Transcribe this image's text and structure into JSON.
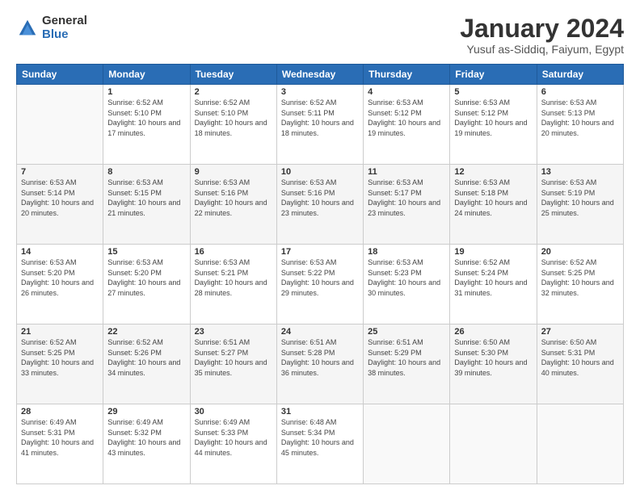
{
  "logo": {
    "general": "General",
    "blue": "Blue"
  },
  "header": {
    "title": "January 2024",
    "subtitle": "Yusuf as-Siddiq, Faiyum, Egypt"
  },
  "weekdays": [
    "Sunday",
    "Monday",
    "Tuesday",
    "Wednesday",
    "Thursday",
    "Friday",
    "Saturday"
  ],
  "weeks": [
    [
      {
        "day": "",
        "sunrise": "",
        "sunset": "",
        "daylight": ""
      },
      {
        "day": "1",
        "sunrise": "Sunrise: 6:52 AM",
        "sunset": "Sunset: 5:10 PM",
        "daylight": "Daylight: 10 hours and 17 minutes."
      },
      {
        "day": "2",
        "sunrise": "Sunrise: 6:52 AM",
        "sunset": "Sunset: 5:10 PM",
        "daylight": "Daylight: 10 hours and 18 minutes."
      },
      {
        "day": "3",
        "sunrise": "Sunrise: 6:52 AM",
        "sunset": "Sunset: 5:11 PM",
        "daylight": "Daylight: 10 hours and 18 minutes."
      },
      {
        "day": "4",
        "sunrise": "Sunrise: 6:53 AM",
        "sunset": "Sunset: 5:12 PM",
        "daylight": "Daylight: 10 hours and 19 minutes."
      },
      {
        "day": "5",
        "sunrise": "Sunrise: 6:53 AM",
        "sunset": "Sunset: 5:12 PM",
        "daylight": "Daylight: 10 hours and 19 minutes."
      },
      {
        "day": "6",
        "sunrise": "Sunrise: 6:53 AM",
        "sunset": "Sunset: 5:13 PM",
        "daylight": "Daylight: 10 hours and 20 minutes."
      }
    ],
    [
      {
        "day": "7",
        "sunrise": "Sunrise: 6:53 AM",
        "sunset": "Sunset: 5:14 PM",
        "daylight": "Daylight: 10 hours and 20 minutes."
      },
      {
        "day": "8",
        "sunrise": "Sunrise: 6:53 AM",
        "sunset": "Sunset: 5:15 PM",
        "daylight": "Daylight: 10 hours and 21 minutes."
      },
      {
        "day": "9",
        "sunrise": "Sunrise: 6:53 AM",
        "sunset": "Sunset: 5:16 PM",
        "daylight": "Daylight: 10 hours and 22 minutes."
      },
      {
        "day": "10",
        "sunrise": "Sunrise: 6:53 AM",
        "sunset": "Sunset: 5:16 PM",
        "daylight": "Daylight: 10 hours and 23 minutes."
      },
      {
        "day": "11",
        "sunrise": "Sunrise: 6:53 AM",
        "sunset": "Sunset: 5:17 PM",
        "daylight": "Daylight: 10 hours and 23 minutes."
      },
      {
        "day": "12",
        "sunrise": "Sunrise: 6:53 AM",
        "sunset": "Sunset: 5:18 PM",
        "daylight": "Daylight: 10 hours and 24 minutes."
      },
      {
        "day": "13",
        "sunrise": "Sunrise: 6:53 AM",
        "sunset": "Sunset: 5:19 PM",
        "daylight": "Daylight: 10 hours and 25 minutes."
      }
    ],
    [
      {
        "day": "14",
        "sunrise": "Sunrise: 6:53 AM",
        "sunset": "Sunset: 5:20 PM",
        "daylight": "Daylight: 10 hours and 26 minutes."
      },
      {
        "day": "15",
        "sunrise": "Sunrise: 6:53 AM",
        "sunset": "Sunset: 5:20 PM",
        "daylight": "Daylight: 10 hours and 27 minutes."
      },
      {
        "day": "16",
        "sunrise": "Sunrise: 6:53 AM",
        "sunset": "Sunset: 5:21 PM",
        "daylight": "Daylight: 10 hours and 28 minutes."
      },
      {
        "day": "17",
        "sunrise": "Sunrise: 6:53 AM",
        "sunset": "Sunset: 5:22 PM",
        "daylight": "Daylight: 10 hours and 29 minutes."
      },
      {
        "day": "18",
        "sunrise": "Sunrise: 6:53 AM",
        "sunset": "Sunset: 5:23 PM",
        "daylight": "Daylight: 10 hours and 30 minutes."
      },
      {
        "day": "19",
        "sunrise": "Sunrise: 6:52 AM",
        "sunset": "Sunset: 5:24 PM",
        "daylight": "Daylight: 10 hours and 31 minutes."
      },
      {
        "day": "20",
        "sunrise": "Sunrise: 6:52 AM",
        "sunset": "Sunset: 5:25 PM",
        "daylight": "Daylight: 10 hours and 32 minutes."
      }
    ],
    [
      {
        "day": "21",
        "sunrise": "Sunrise: 6:52 AM",
        "sunset": "Sunset: 5:25 PM",
        "daylight": "Daylight: 10 hours and 33 minutes."
      },
      {
        "day": "22",
        "sunrise": "Sunrise: 6:52 AM",
        "sunset": "Sunset: 5:26 PM",
        "daylight": "Daylight: 10 hours and 34 minutes."
      },
      {
        "day": "23",
        "sunrise": "Sunrise: 6:51 AM",
        "sunset": "Sunset: 5:27 PM",
        "daylight": "Daylight: 10 hours and 35 minutes."
      },
      {
        "day": "24",
        "sunrise": "Sunrise: 6:51 AM",
        "sunset": "Sunset: 5:28 PM",
        "daylight": "Daylight: 10 hours and 36 minutes."
      },
      {
        "day": "25",
        "sunrise": "Sunrise: 6:51 AM",
        "sunset": "Sunset: 5:29 PM",
        "daylight": "Daylight: 10 hours and 38 minutes."
      },
      {
        "day": "26",
        "sunrise": "Sunrise: 6:50 AM",
        "sunset": "Sunset: 5:30 PM",
        "daylight": "Daylight: 10 hours and 39 minutes."
      },
      {
        "day": "27",
        "sunrise": "Sunrise: 6:50 AM",
        "sunset": "Sunset: 5:31 PM",
        "daylight": "Daylight: 10 hours and 40 minutes."
      }
    ],
    [
      {
        "day": "28",
        "sunrise": "Sunrise: 6:49 AM",
        "sunset": "Sunset: 5:31 PM",
        "daylight": "Daylight: 10 hours and 41 minutes."
      },
      {
        "day": "29",
        "sunrise": "Sunrise: 6:49 AM",
        "sunset": "Sunset: 5:32 PM",
        "daylight": "Daylight: 10 hours and 43 minutes."
      },
      {
        "day": "30",
        "sunrise": "Sunrise: 6:49 AM",
        "sunset": "Sunset: 5:33 PM",
        "daylight": "Daylight: 10 hours and 44 minutes."
      },
      {
        "day": "31",
        "sunrise": "Sunrise: 6:48 AM",
        "sunset": "Sunset: 5:34 PM",
        "daylight": "Daylight: 10 hours and 45 minutes."
      },
      {
        "day": "",
        "sunrise": "",
        "sunset": "",
        "daylight": ""
      },
      {
        "day": "",
        "sunrise": "",
        "sunset": "",
        "daylight": ""
      },
      {
        "day": "",
        "sunrise": "",
        "sunset": "",
        "daylight": ""
      }
    ]
  ]
}
